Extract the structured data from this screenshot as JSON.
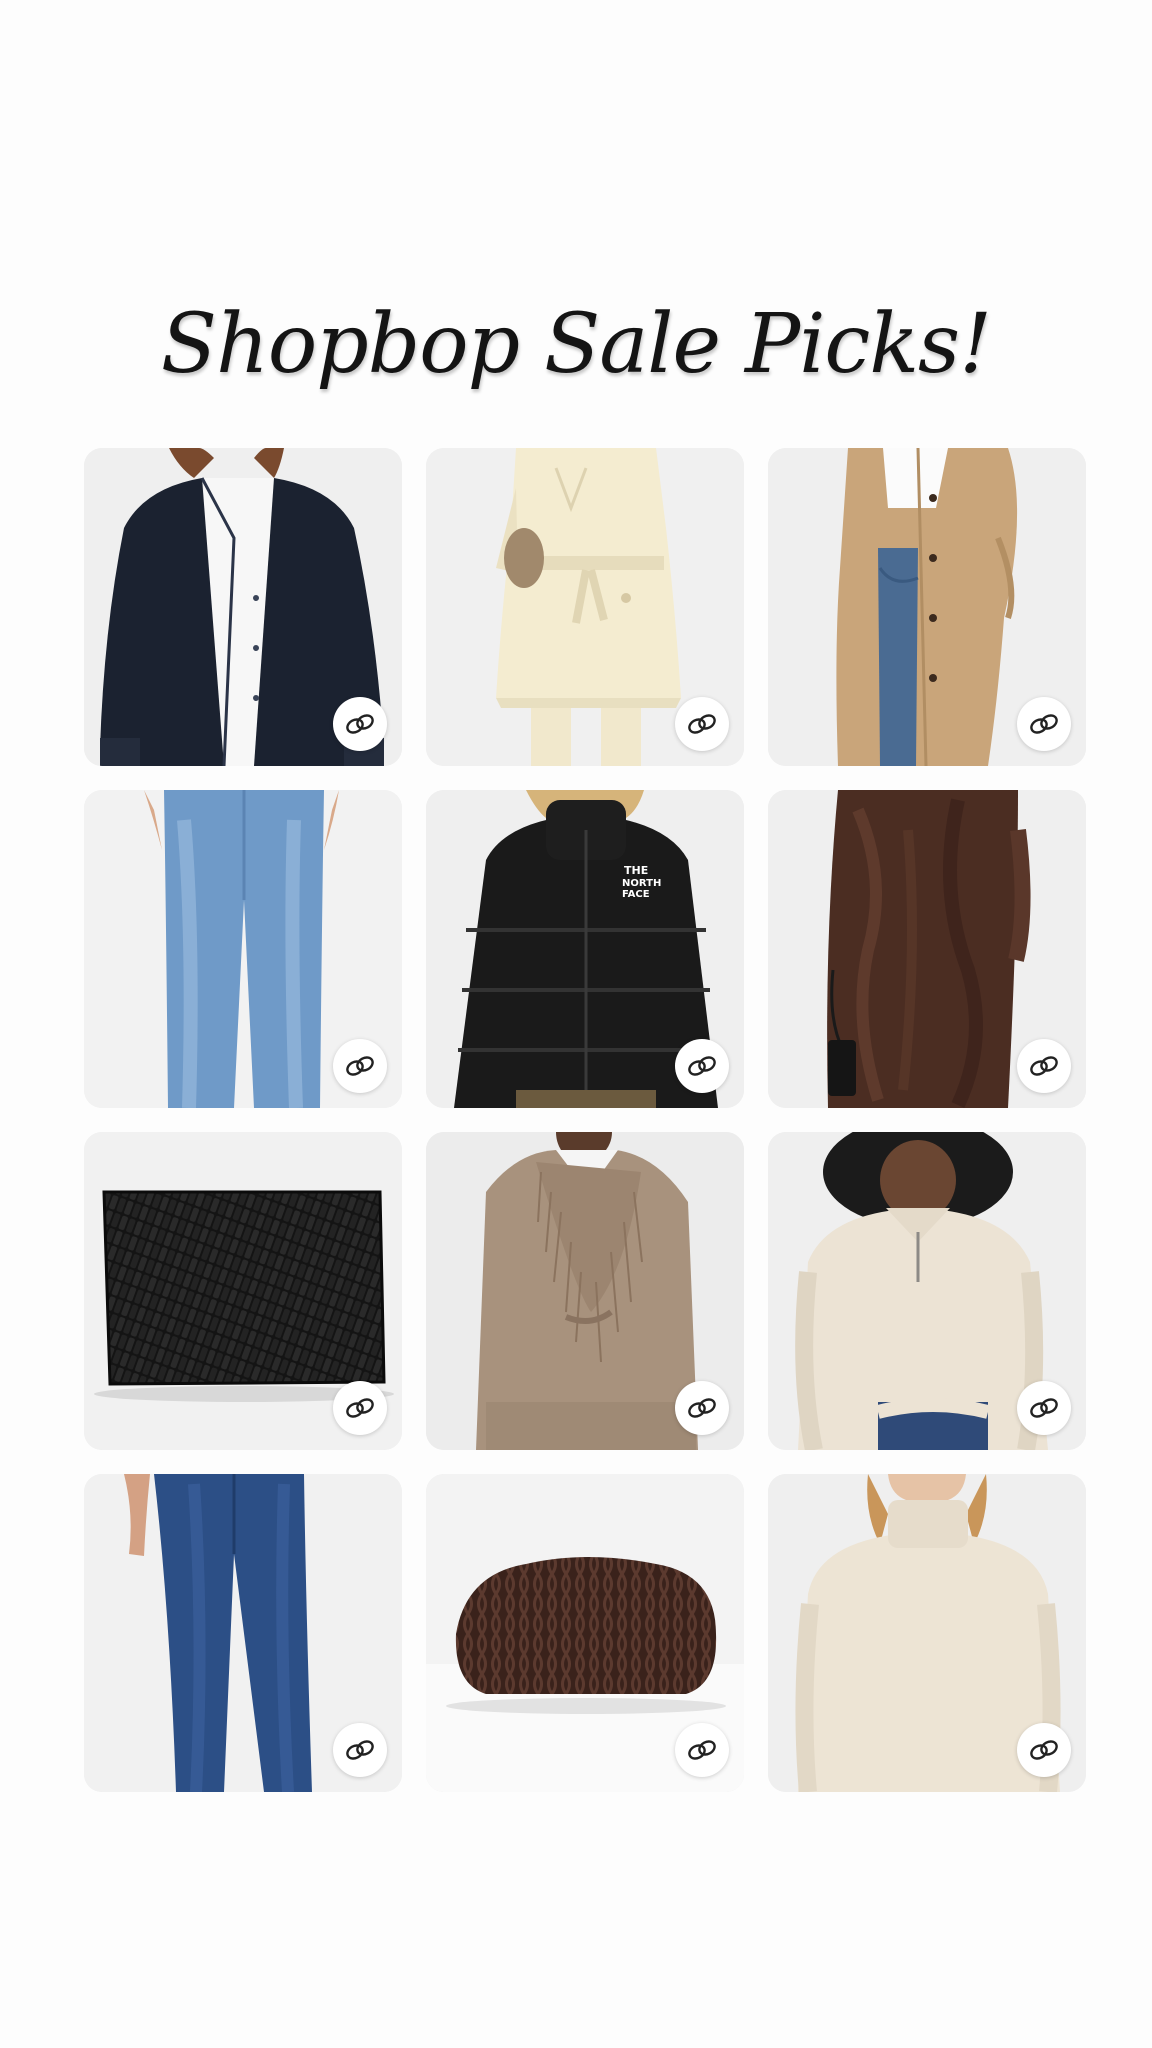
{
  "page": {
    "title": "Shopbop Sale Picks!"
  },
  "products": [
    {
      "name": "navy-barn-jacket",
      "icon": "link-icon"
    },
    {
      "name": "cream-trench-coat",
      "icon": "link-icon"
    },
    {
      "name": "camel-long-coat",
      "icon": "link-icon"
    },
    {
      "name": "light-wash-jeans",
      "icon": "link-icon"
    },
    {
      "name": "black-puffer-jacket",
      "icon": "link-icon"
    },
    {
      "name": "brown-faux-fur-coat",
      "icon": "link-icon"
    },
    {
      "name": "black-woven-clutch",
      "icon": "link-icon"
    },
    {
      "name": "fringe-wrap-cardigan",
      "icon": "link-icon"
    },
    {
      "name": "cream-half-zip-sweater",
      "icon": "link-icon"
    },
    {
      "name": "dark-wash-jeans",
      "icon": "link-icon"
    },
    {
      "name": "brown-quilted-pouch",
      "icon": "link-icon"
    },
    {
      "name": "ivory-turtleneck-sweater",
      "icon": "link-icon"
    }
  ],
  "colors": {
    "background": "#fdfdfd",
    "tile_background": "#ececec",
    "badge_background": "#ffffff",
    "title": "#141414"
  }
}
